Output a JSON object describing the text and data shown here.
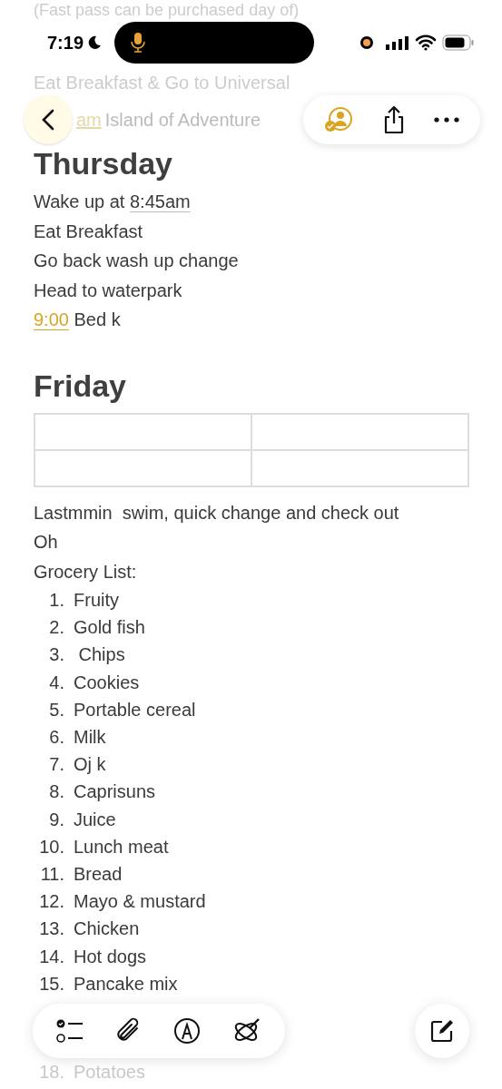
{
  "background_lines": [
    "(Fast pass can be purchased day of)",
    "Eat Breakfast & Go to Universal"
  ],
  "status_bar": {
    "time": "7:19"
  },
  "toolbar": {
    "behind_text_time": "am",
    "behind_text": "Island of Adventure"
  },
  "sections": [
    {
      "heading": "Thursday",
      "lines": [
        {
          "parts": [
            {
              "text": "Wake up at ",
              "kind": "plain"
            },
            {
              "text": "8:45am",
              "kind": "date"
            }
          ]
        },
        {
          "parts": [
            {
              "text": "Eat Breakfast",
              "kind": "plain"
            }
          ]
        },
        {
          "parts": [
            {
              "text": "Go back wash up change",
              "kind": "plain"
            }
          ]
        },
        {
          "parts": [
            {
              "text": "Head to waterpark",
              "kind": "plain"
            }
          ]
        },
        {
          "parts": [
            {
              "text": "9:00",
              "kind": "time"
            },
            {
              "text": " Bed k",
              "kind": "plain"
            }
          ]
        }
      ]
    },
    {
      "heading": "Friday",
      "has_table": true,
      "lines": [
        {
          "parts": [
            {
              "text": "Lastmmin  swim, quick change and check out",
              "kind": "plain"
            }
          ]
        },
        {
          "parts": [
            {
              "text": "Oh",
              "kind": "plain"
            }
          ]
        },
        {
          "parts": [
            {
              "text": "Grocery List:",
              "kind": "plain"
            }
          ]
        }
      ]
    }
  ],
  "list": [
    {
      "number": "1.",
      "text": "Fruity"
    },
    {
      "number": "2.",
      "text": "Gold fish"
    },
    {
      "number": "3.",
      "text": " Chips"
    },
    {
      "number": "4.",
      "text": "Cookies"
    },
    {
      "number": "5.",
      "text": "Portable cereal"
    },
    {
      "number": "6.",
      "text": "Milk"
    },
    {
      "number": "7.",
      "text": "Oj k"
    },
    {
      "number": "8.",
      "text": "Caprisuns"
    },
    {
      "number": "9.",
      "text": "Juice"
    },
    {
      "number": "10.",
      "text": "Lunch meat"
    },
    {
      "number": "11.",
      "text": "Bread"
    },
    {
      "number": "12.",
      "text": "Mayo & mustard"
    },
    {
      "number": "13.",
      "text": "Chicken"
    },
    {
      "number": "14.",
      "text": "Hot dogs"
    },
    {
      "number": "15.",
      "text": "Pancake mix"
    }
  ],
  "faded_list": [
    {
      "number": "18.",
      "text": "Potatoes"
    }
  ]
}
